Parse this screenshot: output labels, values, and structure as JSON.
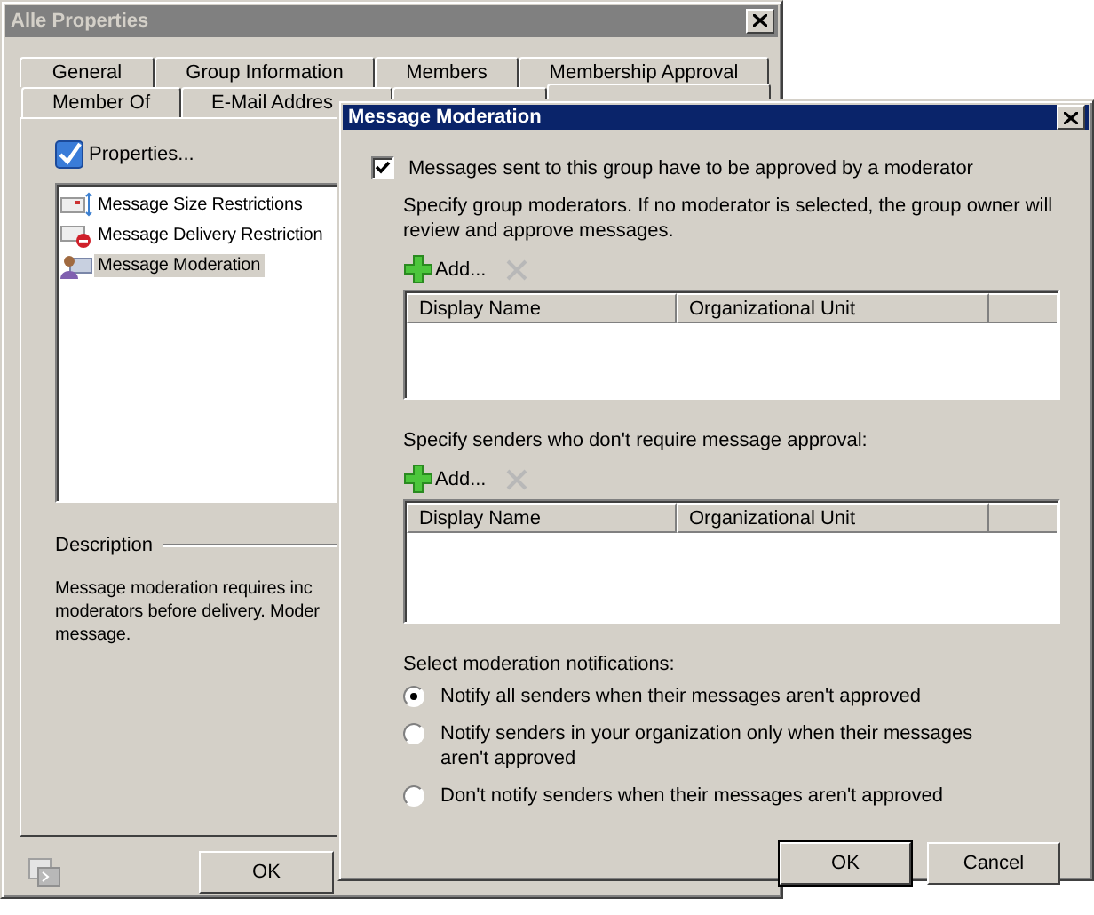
{
  "back_window": {
    "title": "Alle Properties",
    "tab_rows": [
      [
        {
          "label": "General",
          "selected": false
        },
        {
          "label": "Group Information",
          "selected": false
        },
        {
          "label": "Members",
          "selected": false
        },
        {
          "label": "Membership Approval",
          "selected": false
        }
      ],
      [
        {
          "label": "Member Of",
          "selected": false
        },
        {
          "label": "E-Mail Addres",
          "selected": false
        },
        {
          "selected": false
        },
        {
          "selected": true
        }
      ]
    ],
    "properties_button": "Properties...",
    "features": [
      {
        "label": "Message Size Restrictions",
        "kind": "size",
        "selected": false
      },
      {
        "label": "Message Delivery Restriction",
        "kind": "delivery",
        "selected": false
      },
      {
        "label": "Message Moderation",
        "kind": "moderation",
        "selected": true
      }
    ],
    "description": {
      "legend": "Description",
      "lines": [
        "Message moderation requires inc",
        "moderators before delivery. Moder",
        "message."
      ]
    },
    "buttons": [
      "OK"
    ]
  },
  "dialog": {
    "title": "Message Moderation",
    "require_approval": {
      "label": "Messages sent to this group have to be approved by a moderator",
      "checked": true
    },
    "moderators": {
      "intro": "Specify group moderators. If no moderator is selected, the group owner will review and approve messages.",
      "add": "Add...",
      "columns": [
        "Display Name",
        "Organizational Unit"
      ]
    },
    "exempt_senders": {
      "intro": "Specify senders who don't require message approval:",
      "add": "Add...",
      "columns": [
        "Display Name",
        "Organizational Unit"
      ]
    },
    "notifications": {
      "heading": "Select moderation notifications:",
      "options": [
        {
          "label": "Notify all senders when their messages aren't approved",
          "selected": true
        },
        {
          "label": "Notify senders in your organization only when their messages aren't approved",
          "selected": false
        },
        {
          "label": "Don't notify senders when their messages aren't approved",
          "selected": false
        }
      ]
    },
    "buttons": [
      {
        "label": "OK",
        "default": true
      },
      {
        "label": "Cancel",
        "default": false
      }
    ]
  }
}
